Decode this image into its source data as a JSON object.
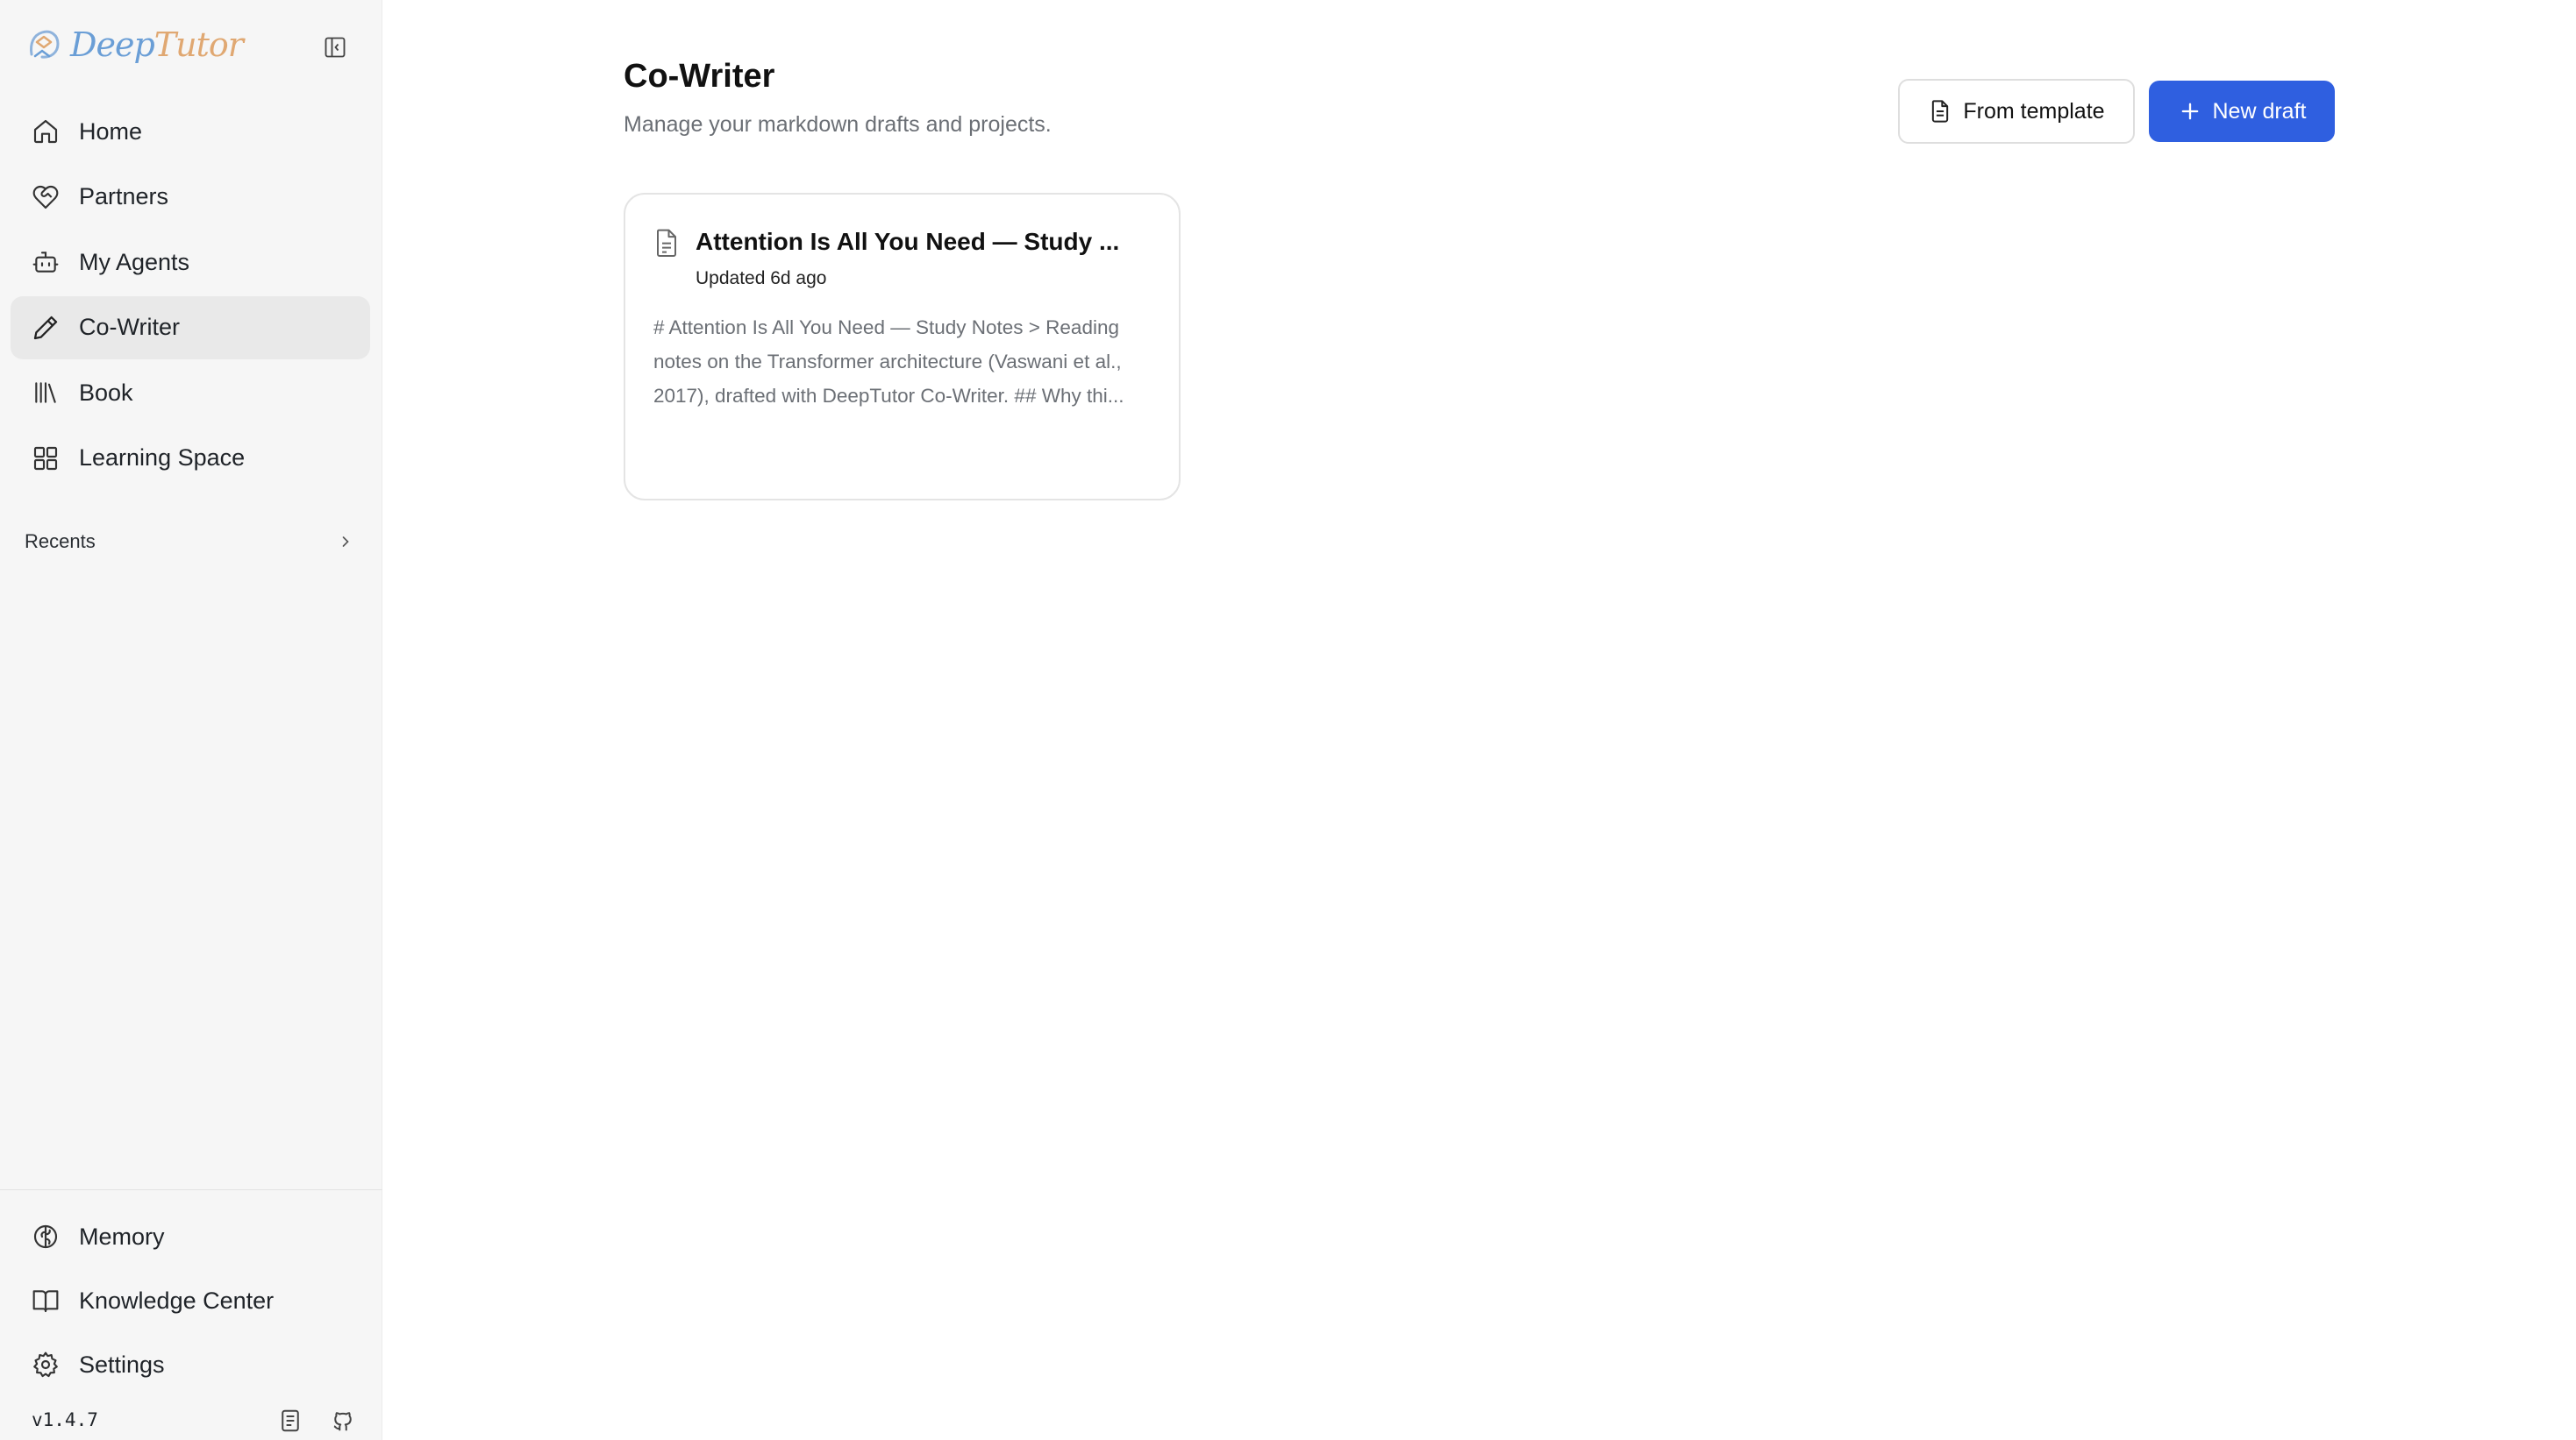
{
  "app": {
    "logo_part1": "Deep",
    "logo_part2": "Tutor",
    "version": "v1.4.7"
  },
  "sidebar": {
    "nav": [
      {
        "label": "Home",
        "icon": "home-icon"
      },
      {
        "label": "Partners",
        "icon": "heart-handshake-icon"
      },
      {
        "label": "My Agents",
        "icon": "bot-icon"
      },
      {
        "label": "Co-Writer",
        "icon": "pen-icon",
        "active": true
      },
      {
        "label": "Book",
        "icon": "library-icon"
      },
      {
        "label": "Learning Space",
        "icon": "grid-icon"
      }
    ],
    "recents_label": "Recents",
    "bottom": [
      {
        "label": "Memory",
        "icon": "brain-icon"
      },
      {
        "label": "Knowledge Center",
        "icon": "book-open-icon"
      },
      {
        "label": "Settings",
        "icon": "gear-icon"
      }
    ]
  },
  "main": {
    "title": "Co-Writer",
    "subtitle": "Manage your markdown drafts and projects.",
    "from_template_label": "From template",
    "new_draft_label": "New draft",
    "drafts": [
      {
        "title": "Attention Is All You Need — Study ...",
        "updated": "Updated 6d ago",
        "excerpt": "# Attention Is All You Need — Study Notes > Reading notes on the Transformer architecture (Vaswani et al., 2017), drafted with DeepTutor Co-Writer. ## Why thi..."
      }
    ]
  },
  "colors": {
    "accent": "#2f5fe0",
    "sidebar_bg": "#f6f6f6",
    "active_item_bg": "#e9e9e9",
    "logo_deep": "#6a9ed6",
    "logo_tutor": "#e0a872"
  }
}
